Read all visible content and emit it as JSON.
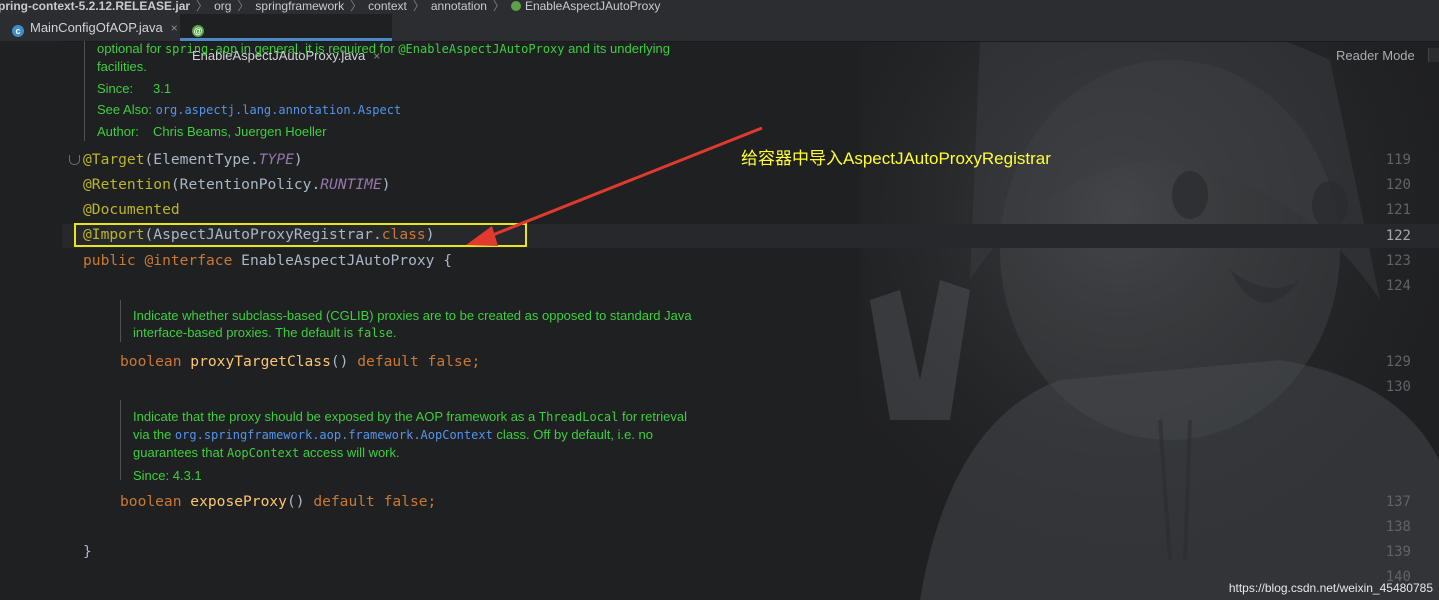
{
  "breadcrumb": {
    "jar": "pring-context-5.2.12.RELEASE.jar",
    "items": [
      "org",
      "springframework",
      "context",
      "annotation"
    ],
    "current": "EnableAspectJAutoProxy"
  },
  "tabs": [
    {
      "label": "MainConfigOfAOP.java",
      "icon": "class-icon",
      "active": false
    },
    {
      "label": "EnableAspectJAutoProxy.java",
      "icon": "annotation-icon",
      "active": true
    }
  ],
  "close_glyph": "×",
  "reader_mode": "Reader Mode",
  "doc_top": {
    "line1_pre": "optional for ",
    "line1_code": "spring-aop",
    "line1_mid": " in general, it is required for ",
    "line1_code2": "@EnableAspectJAutoProxy",
    "line1_post": " and its underlying",
    "line2": "facilities.",
    "since_key": "Since:",
    "since_val": "3.1",
    "seealso_key": "See Also:",
    "seealso_val": "org.aspectj.lang.annotation.Aspect",
    "author_key": "Author:",
    "author_val": "Chris Beams, Juergen Hoeller"
  },
  "line_numbers": [
    "119",
    "120",
    "121",
    "122",
    "123",
    "124",
    "129",
    "130",
    "137",
    "138",
    "139",
    "140"
  ],
  "code": {
    "l119_ann": "@Target",
    "l119_rest": "(ElementType.",
    "l119_it": "TYPE",
    "l119_end": ")",
    "l120_ann": "@Retention",
    "l120_rest": "(RetentionPolicy.",
    "l120_it": "RUNTIME",
    "l120_end": ")",
    "l121_ann": "@Documented",
    "l122_ann": "@Import",
    "l122_rest": "(AspectJAutoProxyRegistrar.",
    "l122_kw": "class",
    "l122_end": ")",
    "l123_kw": "public",
    "l123_ann": " @interface",
    "l123_rest": " EnableAspectJAutoProxy {",
    "l129_kw": "boolean",
    "l129_fn": " proxyTargetClass",
    "l129_mid": "()",
    "l129_kw2": " default false",
    "l129_end": ";",
    "l137_kw": "boolean",
    "l137_fn": " exposeProxy",
    "l137_mid": "()",
    "l137_kw2": " default false",
    "l137_end": ";",
    "l139": "}"
  },
  "doc_mid": {
    "line1": "Indicate whether subclass-based (CGLIB) proxies are to be created as opposed to standard Java",
    "line2_pre": "interface-based proxies. The default is ",
    "line2_code": "false",
    "line2_post": "."
  },
  "doc_low": {
    "line1_pre": "Indicate that the proxy should be exposed by the AOP framework as a ",
    "line1_code": "ThreadLocal",
    "line1_post": " for retrieval",
    "line2_pre": "via the ",
    "line2_link": "org.springframework.aop.framework.AopContext",
    "line2_post": " class. Off by default, i.e. no",
    "line3_pre": "guarantees that ",
    "line3_code": "AopContext",
    "line3_post": " access will work.",
    "since": "Since: 4.3.1"
  },
  "annotation": {
    "callout": "给容器中导入AspectJAutoProxyRegistrar",
    "box_color": "#e8e51a",
    "arrow_color": "#e03a2f",
    "callout_color": "#ffff33"
  },
  "watermark": "https://blog.csdn.net/weixin_45480785"
}
